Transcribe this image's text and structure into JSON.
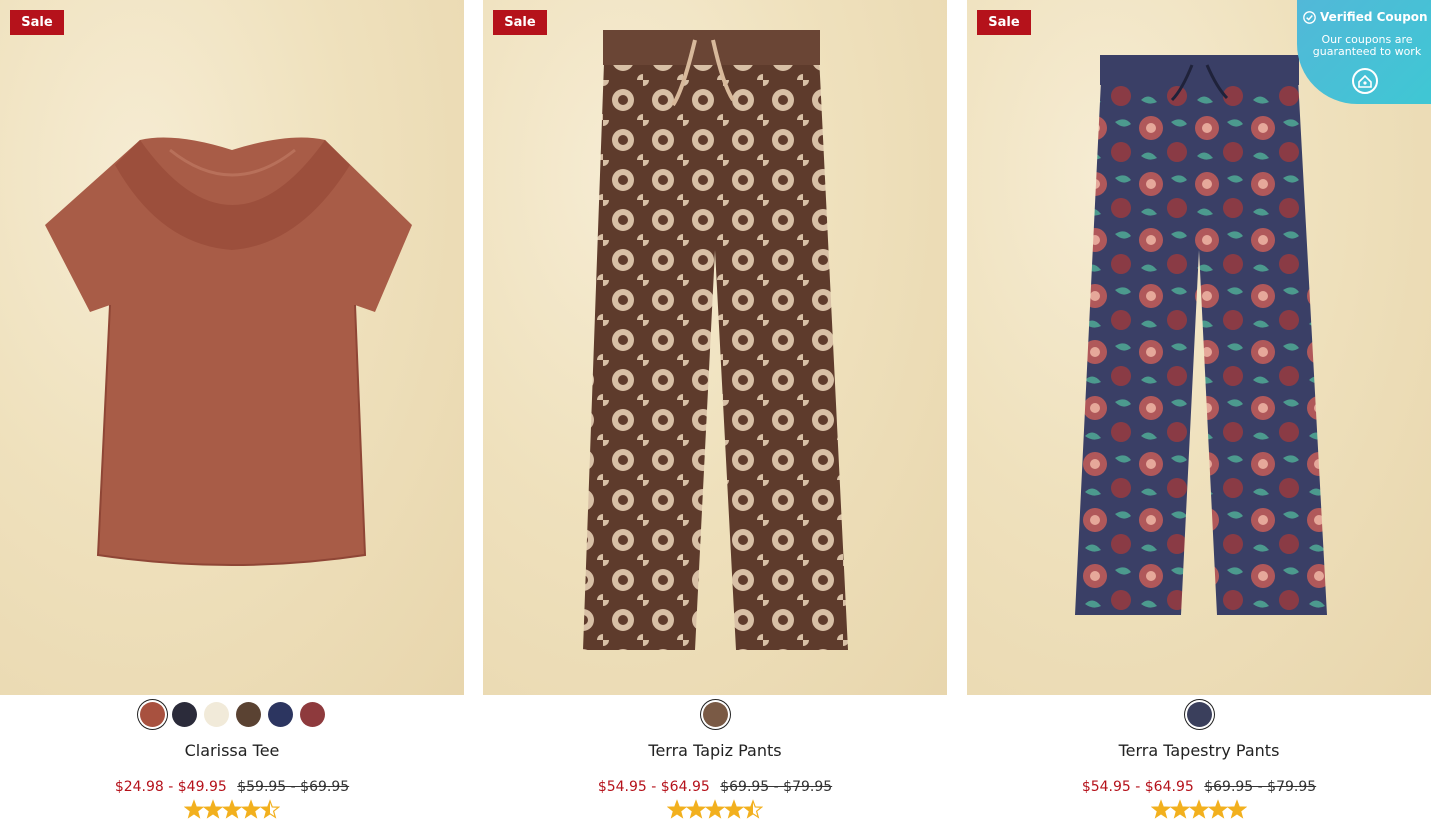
{
  "coupon": {
    "title": "Verified Coupon",
    "description": "Our coupons are guaranteed to work"
  },
  "products": [
    {
      "badge": "Sale",
      "name": "Clarissa Tee",
      "sale_price": "$24.98 - $49.95",
      "original_price": "$59.95 - $69.95",
      "rating": 4.5,
      "swatches": [
        "#a8513f",
        "#2b2b3a",
        "#f1ead9",
        "#5a4232",
        "#2c3560",
        "#8e3a3d"
      ],
      "selected_swatch": 0
    },
    {
      "badge": "Sale",
      "name": "Terra Tapiz Pants",
      "sale_price": "$54.95 - $64.95",
      "original_price": "$69.95 - $79.95",
      "rating": 4.5,
      "swatches": [
        "#7a5a45"
      ],
      "selected_swatch": 0
    },
    {
      "badge": "Sale",
      "name": "Terra Tapestry Pants",
      "sale_price": "$54.95 - $64.95",
      "original_price": "$69.95 - $79.95",
      "rating": 5,
      "swatches": [
        "#3a3f5c"
      ],
      "selected_swatch": 0
    }
  ],
  "colors": {
    "sale_red": "#b5121b",
    "star_gold": "#f2b01e",
    "coupon_teal": "#3fc7d4"
  }
}
